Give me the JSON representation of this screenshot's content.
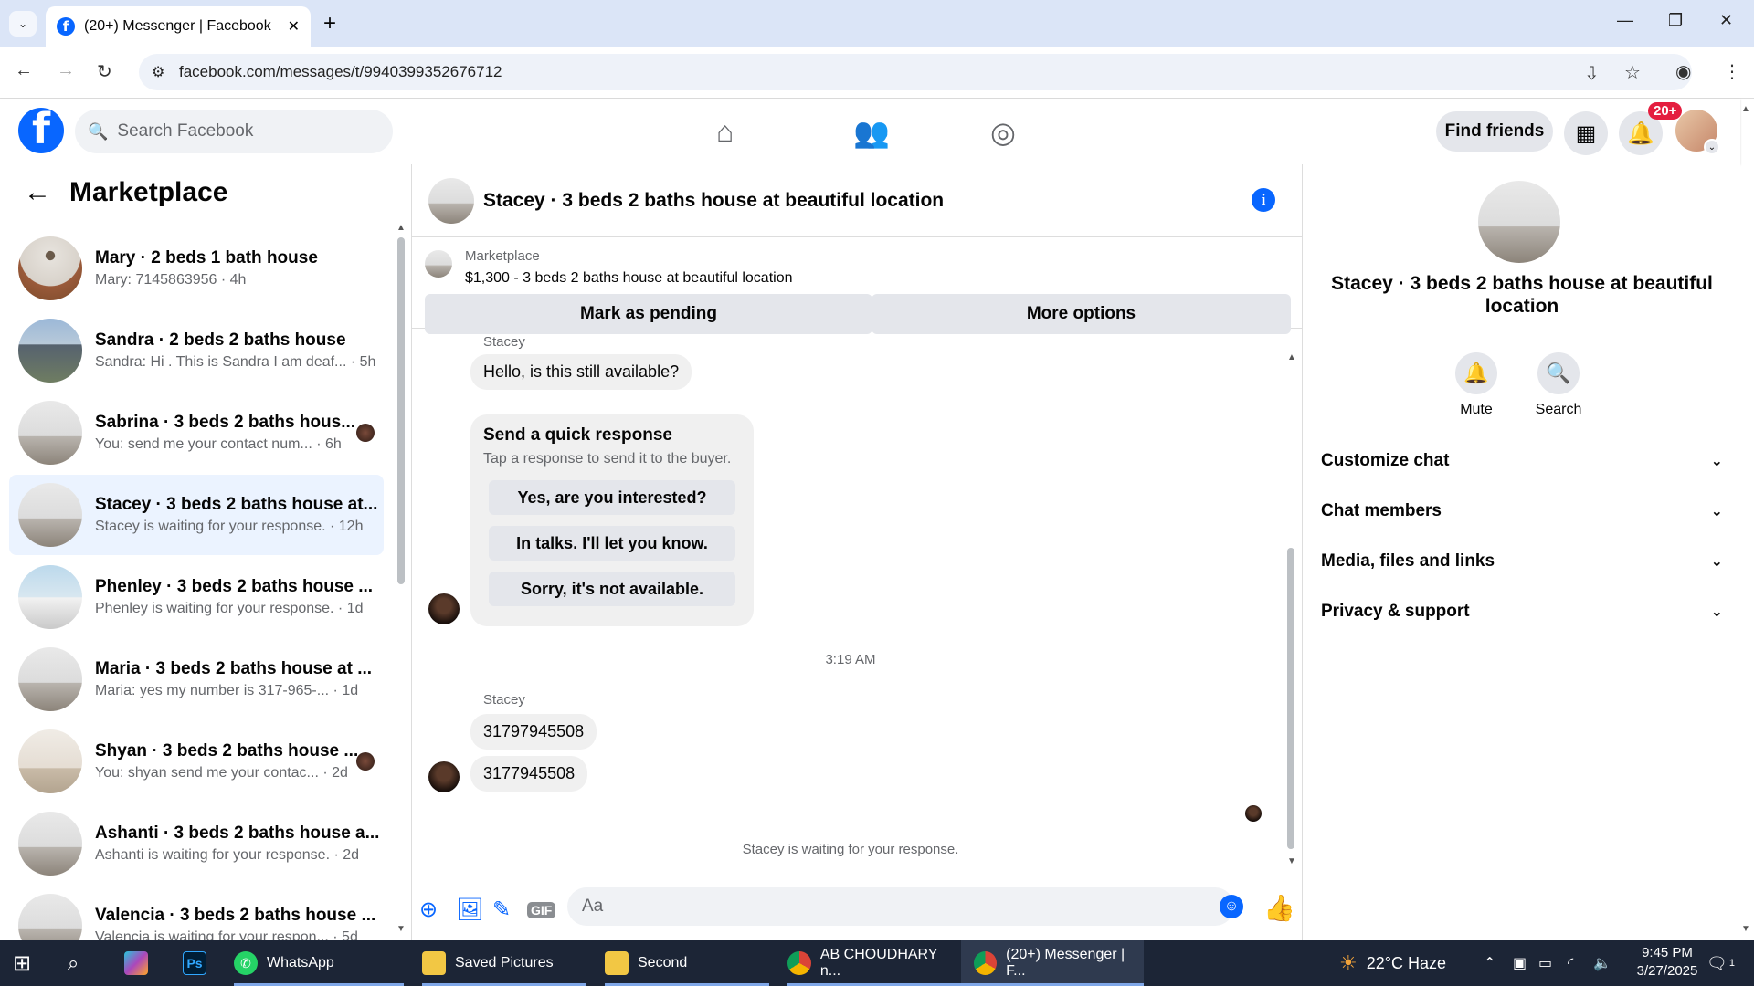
{
  "browser": {
    "tab_title": "(20+) Messenger | Facebook",
    "url": "facebook.com/messages/t/9940399352676712"
  },
  "header": {
    "search_placeholder": "Search Facebook",
    "find_friends": "Find friends",
    "notifications_badge": "20+"
  },
  "left": {
    "title": "Marketplace",
    "conversations": [
      {
        "name": "Mary · 2 beds 1 bath house",
        "preview": "Mary: 7145863956 · 4h",
        "thumb": "fan"
      },
      {
        "name": "Sandra · 2 beds 2 baths house",
        "preview": "Sandra: Hi . This is Sandra I am deaf... · 5h",
        "thumb": "house"
      },
      {
        "name": "Sabrina · 3 beds 2 baths hous...",
        "preview": "You: send me your contact num... · 6h",
        "thumb": "room"
      },
      {
        "name": "Stacey · 3 beds 2 baths house at...",
        "preview": "Stacey is waiting for your response. · 12h",
        "thumb": "room"
      },
      {
        "name": "Phenley · 3 beds 2 baths house ...",
        "preview": "Phenley is waiting for your response. · 1d",
        "thumb": "bed"
      },
      {
        "name": "Maria · 3 beds 2 baths house at ...",
        "preview": "Maria: yes my number is 317-965-... · 1d",
        "thumb": "room"
      },
      {
        "name": "Shyan · 3 beds 2 baths house ...",
        "preview": "You: shyan send me your contac... · 2d",
        "thumb": "empty"
      },
      {
        "name": "Ashanti · 3 beds 2 baths house a...",
        "preview": "Ashanti is waiting for your response. · 2d",
        "thumb": "room"
      },
      {
        "name": "Valencia · 3 beds 2 baths house ...",
        "preview": "Valencia is waiting for your respon... · 5d",
        "thumb": "room"
      }
    ]
  },
  "chat": {
    "title": "Stacey · 3 beds 2 baths house at beautiful location",
    "marketplace_label": "Marketplace",
    "listing": "$1,300 - 3 beds 2 baths house at beautiful location",
    "mark_pending": "Mark as pending",
    "more_options": "More options",
    "sender": "Stacey",
    "first_message": "Hello, is this still available?",
    "quick_title": "Send a quick response",
    "quick_sub": "Tap a response to send it to the buyer.",
    "quick_options": [
      "Yes, are you interested?",
      "In talks. I'll let you know.",
      "Sorry, it's not available."
    ],
    "timestamp": "3:19 AM",
    "msg2": "31797945508",
    "msg3": "3177945508",
    "waiting": "Stacey is waiting for your response.",
    "composer_placeholder": "Aa"
  },
  "right": {
    "name": "Stacey · 3 beds 2 baths house at beautiful location",
    "mute": "Mute",
    "search": "Search",
    "sections": [
      "Customize chat",
      "Chat members",
      "Media, files and links",
      "Privacy & support"
    ]
  },
  "taskbar": {
    "whatsapp": "WhatsApp",
    "saved_pictures": "Saved Pictures",
    "second": "Second",
    "chrome1": "AB CHOUDHARY n...",
    "chrome2": "(20+) Messenger | F...",
    "weather": "22°C  Haze",
    "time": "9:45 PM",
    "date": "3/27/2025",
    "notif_count": "1",
    "ps_label": "Ps"
  }
}
